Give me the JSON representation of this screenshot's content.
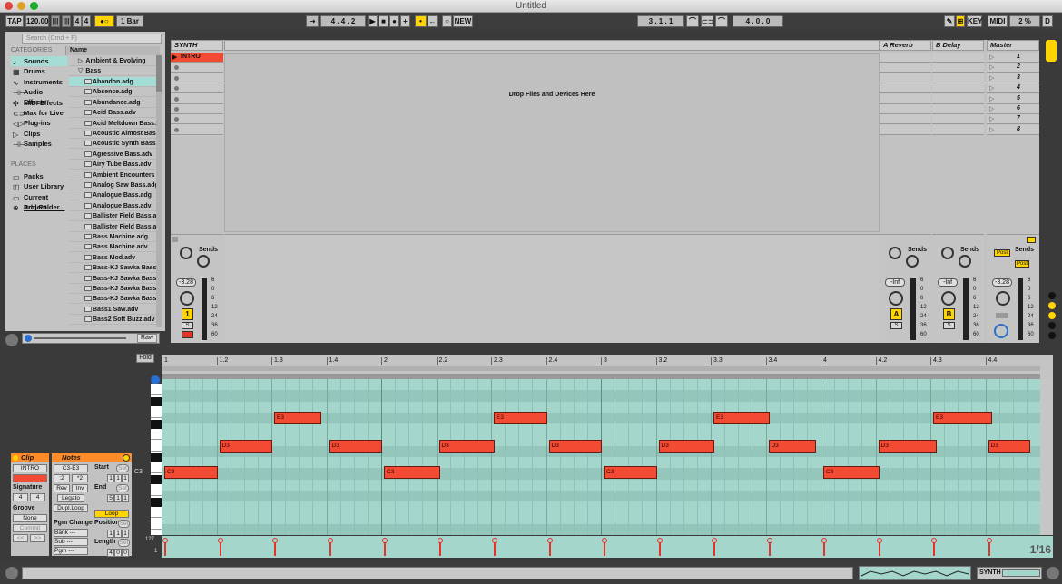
{
  "window": {
    "title": "Untitled"
  },
  "transport": {
    "tap": "TAP",
    "tempo": "120.00",
    "signature_num": "4",
    "signature_den": "4",
    "quantize": "1 Bar",
    "position": "4 . 4 . 2",
    "new_label": "NEW",
    "loop_start": "3 . 1 . 1",
    "loop_length": "4 . 0 . 0",
    "key": "KEY",
    "midi": "MIDI",
    "cpu": "2 %",
    "disk": "D"
  },
  "browser": {
    "search_placeholder": "Search (Cmd + F)",
    "categories_header": "CATEGORIES",
    "name_header": "Name",
    "categories": [
      {
        "label": "Sounds",
        "icon": "♪",
        "selected": true
      },
      {
        "label": "Drums",
        "icon": "▦"
      },
      {
        "label": "Instruments",
        "icon": "∿"
      },
      {
        "label": "Audio Effects",
        "icon": "⊣⊢"
      },
      {
        "label": "MIDI Effects",
        "icon": "✣"
      },
      {
        "label": "Max for Live",
        "icon": "⊂⊃"
      },
      {
        "label": "Plug-ins",
        "icon": "◁▷"
      },
      {
        "label": "Clips",
        "icon": "▷"
      },
      {
        "label": "Samples",
        "icon": "⊣⊢"
      }
    ],
    "places_header": "PLACES",
    "places": [
      {
        "label": "Packs",
        "icon": "▭"
      },
      {
        "label": "User Library",
        "icon": "◫"
      },
      {
        "label": "Current Project",
        "icon": "▭"
      },
      {
        "label": "Add Folder...",
        "icon": "⊕"
      }
    ],
    "folders": [
      {
        "label": "Ambient & Evolving",
        "arrow": "▷"
      },
      {
        "label": "Bass",
        "arrow": "▽"
      }
    ],
    "files": [
      "Abandon.adg",
      "Absence.adg",
      "Abundance.adg",
      "Acid Bass.adv",
      "Acid Meltdown Bass...",
      "Acoustic Almost Bas...",
      "Acoustic Synth Bass...",
      "Agressive Bass.adv",
      "Airy Tube Bass.adv",
      "Ambient Encounters ...",
      "Analog Saw Bass.adg",
      "Analogue Bass.adg",
      "Analogue Bass.adv",
      "Ballister Field Bass.a...",
      "Ballister Field Bass.a...",
      "Bass Machine.adg",
      "Bass Machine.adv",
      "Bass Mod.adv",
      "Bass-KJ Sawka Bass...",
      "Bass-KJ Sawka Bass...",
      "Bass-KJ Sawka Bass...",
      "Bass-KJ Sawka Bass...",
      "Bass1 Saw.adv",
      "Bass2 Soft Buzz.adv"
    ],
    "selected_file": 0,
    "raw_label": "Raw"
  },
  "session": {
    "tracks": [
      {
        "name": "SYNTH"
      },
      {
        "name": "A Reverb"
      },
      {
        "name": "B Delay"
      },
      {
        "name": "Master"
      }
    ],
    "clip_name": "INTRO",
    "drop_text": "Drop Files and Devices Here",
    "scenes": [
      "1",
      "2",
      "3",
      "4",
      "5",
      "6",
      "7",
      "8"
    ],
    "sends_label": "Sends",
    "synth_volume": "-3.28",
    "synth_track_number": "1",
    "solo": "S",
    "return_a_volume": "-Inf",
    "return_b_volume": "-Inf",
    "master_volume": "-3.28",
    "return_a_letter": "A",
    "return_b_letter": "B",
    "post_label": "Post",
    "send_a": "A",
    "send_b": "B",
    "meter_scale": [
      "6",
      "0",
      "6",
      "12",
      "24",
      "36",
      "60"
    ]
  },
  "clip_view": {
    "title": "Clip",
    "clip_name": "INTRO",
    "signature_label": "Signature",
    "sig_num": "4",
    "sig_den": "4",
    "groove_label": "Groove",
    "groove_value": "None",
    "commit": "Commit",
    "tab_l": "<<",
    "tab_r": ">>"
  },
  "notes_view": {
    "title": "Notes",
    "range": "C3-E3",
    "div2": ":2",
    "mul2": "*2",
    "rev": "Rev",
    "inv": "Inv",
    "legato": "Legato",
    "dupl": "Dupl.Loop",
    "start_label": "Start",
    "start_vals": [
      "1",
      "1",
      "1"
    ],
    "end_label": "End",
    "end_vals": [
      "5",
      "1",
      "1"
    ],
    "set": "Set",
    "loop": "Loop",
    "position_label": "Position",
    "position_vals": [
      "1",
      "1",
      "1"
    ],
    "length_label": "Length",
    "length_vals": [
      "4",
      "0",
      "0"
    ],
    "pgm_change": "Pgm Change",
    "bank": "Bank ---",
    "sub": "Sub ---",
    "pgm": "Pgm ---"
  },
  "piano_roll": {
    "fold": "Fold",
    "ruler": [
      "1",
      "1.2",
      "1.3",
      "1.4",
      "2",
      "2.2",
      "2.3",
      "2.4",
      "3",
      "3.2",
      "3.3",
      "3.4",
      "4",
      "4.2",
      "4.3",
      "4.4"
    ],
    "key_label": "C3",
    "velocity_max": "127",
    "velocity_min": "1",
    "grid": "1/16",
    "notes": [
      {
        "p": "C3",
        "s": 0,
        "l": 1
      },
      {
        "p": "D3",
        "s": 1,
        "l": 1
      },
      {
        "p": "E3",
        "s": 2,
        "l": 0.9
      },
      {
        "p": "D3",
        "s": 3,
        "l": 1
      },
      {
        "p": "C3",
        "s": 4,
        "l": 1.05
      },
      {
        "p": "D3",
        "s": 5,
        "l": 1.05
      },
      {
        "p": "E3",
        "s": 6,
        "l": 1
      },
      {
        "p": "D3",
        "s": 7,
        "l": 1
      },
      {
        "p": "C3",
        "s": 8,
        "l": 1
      },
      {
        "p": "D3",
        "s": 9,
        "l": 1.05
      },
      {
        "p": "E3",
        "s": 10,
        "l": 1.05
      },
      {
        "p": "D3",
        "s": 11,
        "l": 0.9
      },
      {
        "p": "C3",
        "s": 12,
        "l": 1.05
      },
      {
        "p": "D3",
        "s": 13,
        "l": 1.1
      },
      {
        "p": "E3",
        "s": 14,
        "l": 1.1
      },
      {
        "p": "D3",
        "s": 15,
        "l": 0.8
      }
    ]
  },
  "status": {
    "track_name": "SYNTH"
  },
  "colors": {
    "accent": "#ffd400",
    "clip": "#f24a33",
    "roll": "#a4d6cc",
    "header": "#ff8c28",
    "selection": "#a6dcd6"
  }
}
